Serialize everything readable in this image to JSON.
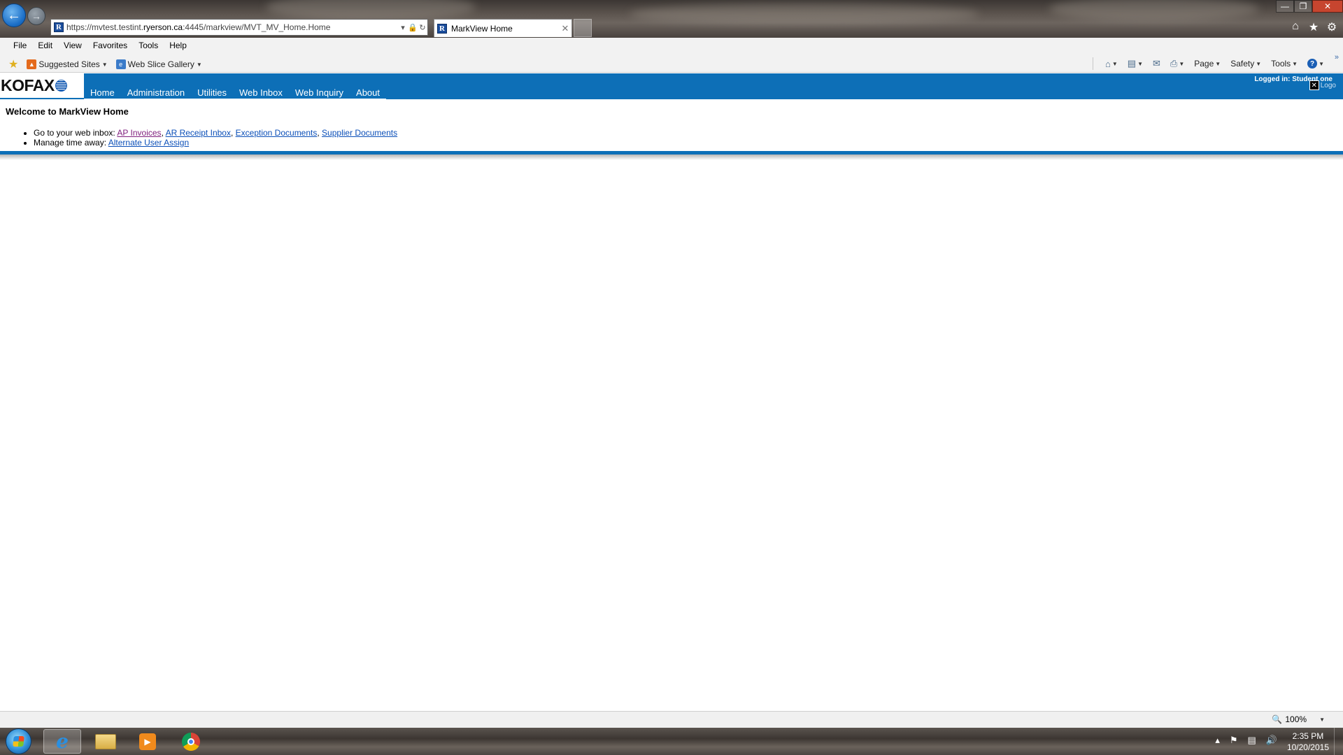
{
  "browser": {
    "url": {
      "prefix": "https://mvtest.testint.",
      "host": "ryerson.ca",
      "suffix": ":4445/markview/MVT_MV_Home.Home"
    },
    "tab_title": "MarkView Home",
    "favicon": "R",
    "menu": [
      "File",
      "Edit",
      "View",
      "Favorites",
      "Tools",
      "Help"
    ],
    "favorites_bar": {
      "suggested_sites": "Suggested Sites",
      "web_slice_gallery": "Web Slice Gallery"
    },
    "command_bar": {
      "page": "Page",
      "safety": "Safety",
      "tools": "Tools"
    },
    "zoom": "100%"
  },
  "app": {
    "logo": "KOFAX",
    "nav": [
      "Home",
      "Administration",
      "Utilities",
      "Web Inbox",
      "Web Inquiry",
      "About"
    ],
    "login_label": "Logged in:",
    "login_user": "Student one",
    "logout_label": "Logo"
  },
  "content": {
    "heading": "Welcome to MarkView Home",
    "inbox_prefix": "Go to your web inbox:",
    "inbox_links": [
      "AP Invoices",
      "AR Receipt Inbox",
      "Exception Documents",
      "Supplier Documents"
    ],
    "timeaway_prefix": "Manage time away:",
    "timeaway_link": "Alternate User Assign"
  },
  "taskbar": {
    "time": "2:35 PM",
    "date": "10/20/2015"
  },
  "colors": {
    "brand_blue": "#0d6fb7",
    "link": "#0b4fb8",
    "link_visited": "#80207e"
  }
}
